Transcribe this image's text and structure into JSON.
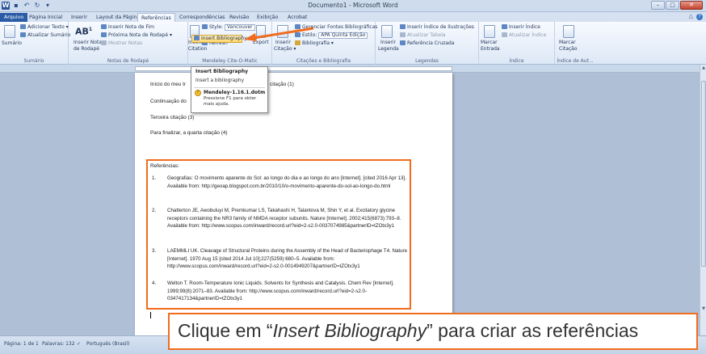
{
  "window": {
    "title": "Documento1 - Microsoft Word",
    "minimize": "–",
    "maximize": "▢",
    "close": "✕"
  },
  "qat": {
    "word": "W",
    "save": "▪",
    "undo": "↶",
    "redo": "↻",
    "customize": "▾"
  },
  "tabs": [
    "Arquivo",
    "Página Inicial",
    "Inserir",
    "Layout da Página",
    "Referências",
    "Correspondências",
    "Revisão",
    "Exibição",
    "Acrobat"
  ],
  "ribbon": {
    "sumario": {
      "button": "Sumário",
      "add_text": "Adicionar Texto ▾",
      "update": "Atualizar Sumário",
      "group": "Sumário"
    },
    "notas": {
      "insert_footnote": "Inserir Nota de Fim",
      "next_footnote": "Próxima Nota de Rodapé ▾",
      "show_notes": "Mostrar Notas",
      "insert_note": "Inserir Nota",
      "de_rodape": "de Rodapé",
      "ab_icon": "AB",
      "ab_sup": "1",
      "group": "Notas de Rodapé"
    },
    "mendeley": {
      "insert_label": "Insert",
      "citation_label": "Citation",
      "style_label": "Style:",
      "style_value": "Vancouver",
      "insert_bibliography": "Insert Bibliography",
      "refresh": "Refresh",
      "export": "Export",
      "group": "Mendeley Cite-O-Matic"
    },
    "citacoes": {
      "insert": "Inserir",
      "citation": "Citação ▾",
      "manage": "Gerenciar Fontes Bibliográficas",
      "style_label": "Estilo:",
      "style_value": "APA Quinta Edição",
      "bibliography": "Bibliografia ▾",
      "group": "Citações e Bibliografia"
    },
    "legendas": {
      "insert": "Inserir",
      "legend": "Legenda",
      "insert_index": "Inserir Índice de Ilustrações",
      "update_table": "Atualizar Tabela",
      "cross_ref": "Referência Cruzada",
      "group": "Legendas"
    },
    "indice": {
      "mark": "Marcar",
      "entry": "Entrada",
      "insert_index": "Inserir Índice",
      "update_index": "Atualizar Índice",
      "group": "Índice"
    },
    "citacao_aut": {
      "mark": "Marcar",
      "citation": "Citação",
      "group": "Índice de Aut..."
    }
  },
  "popup": {
    "title": "Insert Bibliography",
    "subtitle": "Insert a bibliography",
    "file": "Mendeley-1.16.1.dotm",
    "help": "Pressione F1 para obter mais ajuda."
  },
  "document": {
    "lines": [
      "Início do meu tr",
      "citação (1)",
      "Continuação do",
      "",
      "Terceira citação (3)",
      "Para finalizar, a quarta citação (4)"
    ],
    "references_heading": "Referências:",
    "references": [
      {
        "num": "1.",
        "text": "Geografias: O movimento aparente do Sol: ao longo do dia e ao longo do ano [Internet]. [cited 2016 Apr 13]. Available from: http://geoap.blogspot.com.br/2010/10/o-movimento-aparente-do-sol-ao-longo-do.html"
      },
      {
        "num": "2.",
        "text": "Chatterton JE, Awobuluyi M, Premkumar LS, Takahashi H, Talantova M, Shin Y, et al. Excitatory glycine receptors containing the NR3 family of NMDA receptor subunits. Nature [Internet]. 2002;415(6873):793–8. Available from: http://www.scopus.com/inward/record.url?eid=2-s2.0-0037074985&partnerID=tZOtx3y1"
      },
      {
        "num": "3.",
        "text": "LAEMMLI UK. Cleavage of Structural Proteins during the Assembly of the Head of Bacteriophage T4. Nature [Internet]. 1970 Aug 15 [cited 2014 Jul 10];227(5259):680–5. Available from: http://www.scopus.com/inward/record.url?eid=2-s2.0-0014949207&partnerID=tZOtx3y1"
      },
      {
        "num": "4.",
        "text": "Welton T. Room-Temperature Ionic Liquids. Solvents for Synthesis and Catalysis. Chem Rev [Internet]. 1999;99(8):2071–83. Available from: http://www.scopus.com/inward/record.url?eid=2-s2.0-0347417134&partnerID=tZOtx3y1"
      }
    ]
  },
  "status": {
    "page": "Página: 1 de 1",
    "words": "Palavras: 132",
    "language": "Português (Brasil)"
  },
  "caption": {
    "before": "Clique em “",
    "italic": "Insert Bibliography",
    "after": "” para criar as referências"
  },
  "colors": {
    "highlight": "#f06c1d",
    "file_tab": "#2a5ba6"
  }
}
